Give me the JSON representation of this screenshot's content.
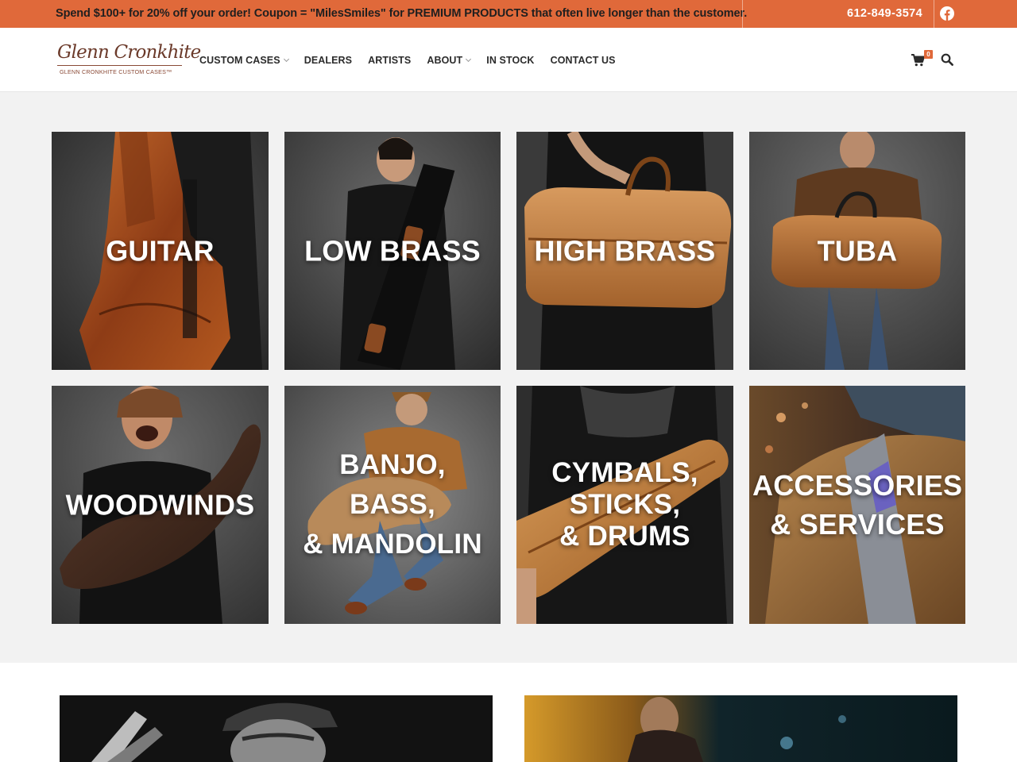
{
  "promo_bar": {
    "message": "Spend $100+ for 20% off your order! Coupon = \"MilesSmiles\" for PREMIUM PRODUCTS that often live longer than the customer.",
    "phone": "612-849-3574",
    "social_icon": "facebook-icon",
    "background_color": "#e0693a"
  },
  "header": {
    "logo_script": "Glenn Cronkhite",
    "logo_tagline": "GLENN CRONKHITE CUSTOM CASES™",
    "nav": [
      {
        "label": "CUSTOM CASES",
        "has_dropdown": true
      },
      {
        "label": "DEALERS",
        "has_dropdown": false
      },
      {
        "label": "ARTISTS",
        "has_dropdown": false
      },
      {
        "label": "ABOUT",
        "has_dropdown": true
      },
      {
        "label": "IN STOCK",
        "has_dropdown": false
      },
      {
        "label": "CONTACT US",
        "has_dropdown": false
      }
    ],
    "cart_count": "0",
    "cart_icon": "shopping-cart-icon",
    "search_icon": "search-icon"
  },
  "categories": [
    {
      "label": "GUITAR"
    },
    {
      "label": "LOW BRASS"
    },
    {
      "label": "HIGH BRASS"
    },
    {
      "label": "TUBA"
    },
    {
      "label": "WOODWINDS"
    },
    {
      "label": "BANJO,\nBASS,\n& MANDOLIN"
    },
    {
      "label": "CYMBALS,\nSTICKS,\n& DRUMS"
    },
    {
      "label": "ACCESSORIES\n& SERVICES"
    }
  ],
  "features": [
    {
      "image": "artist-with-guitar-photo"
    },
    {
      "image": "artist-night-scene-photo"
    }
  ]
}
